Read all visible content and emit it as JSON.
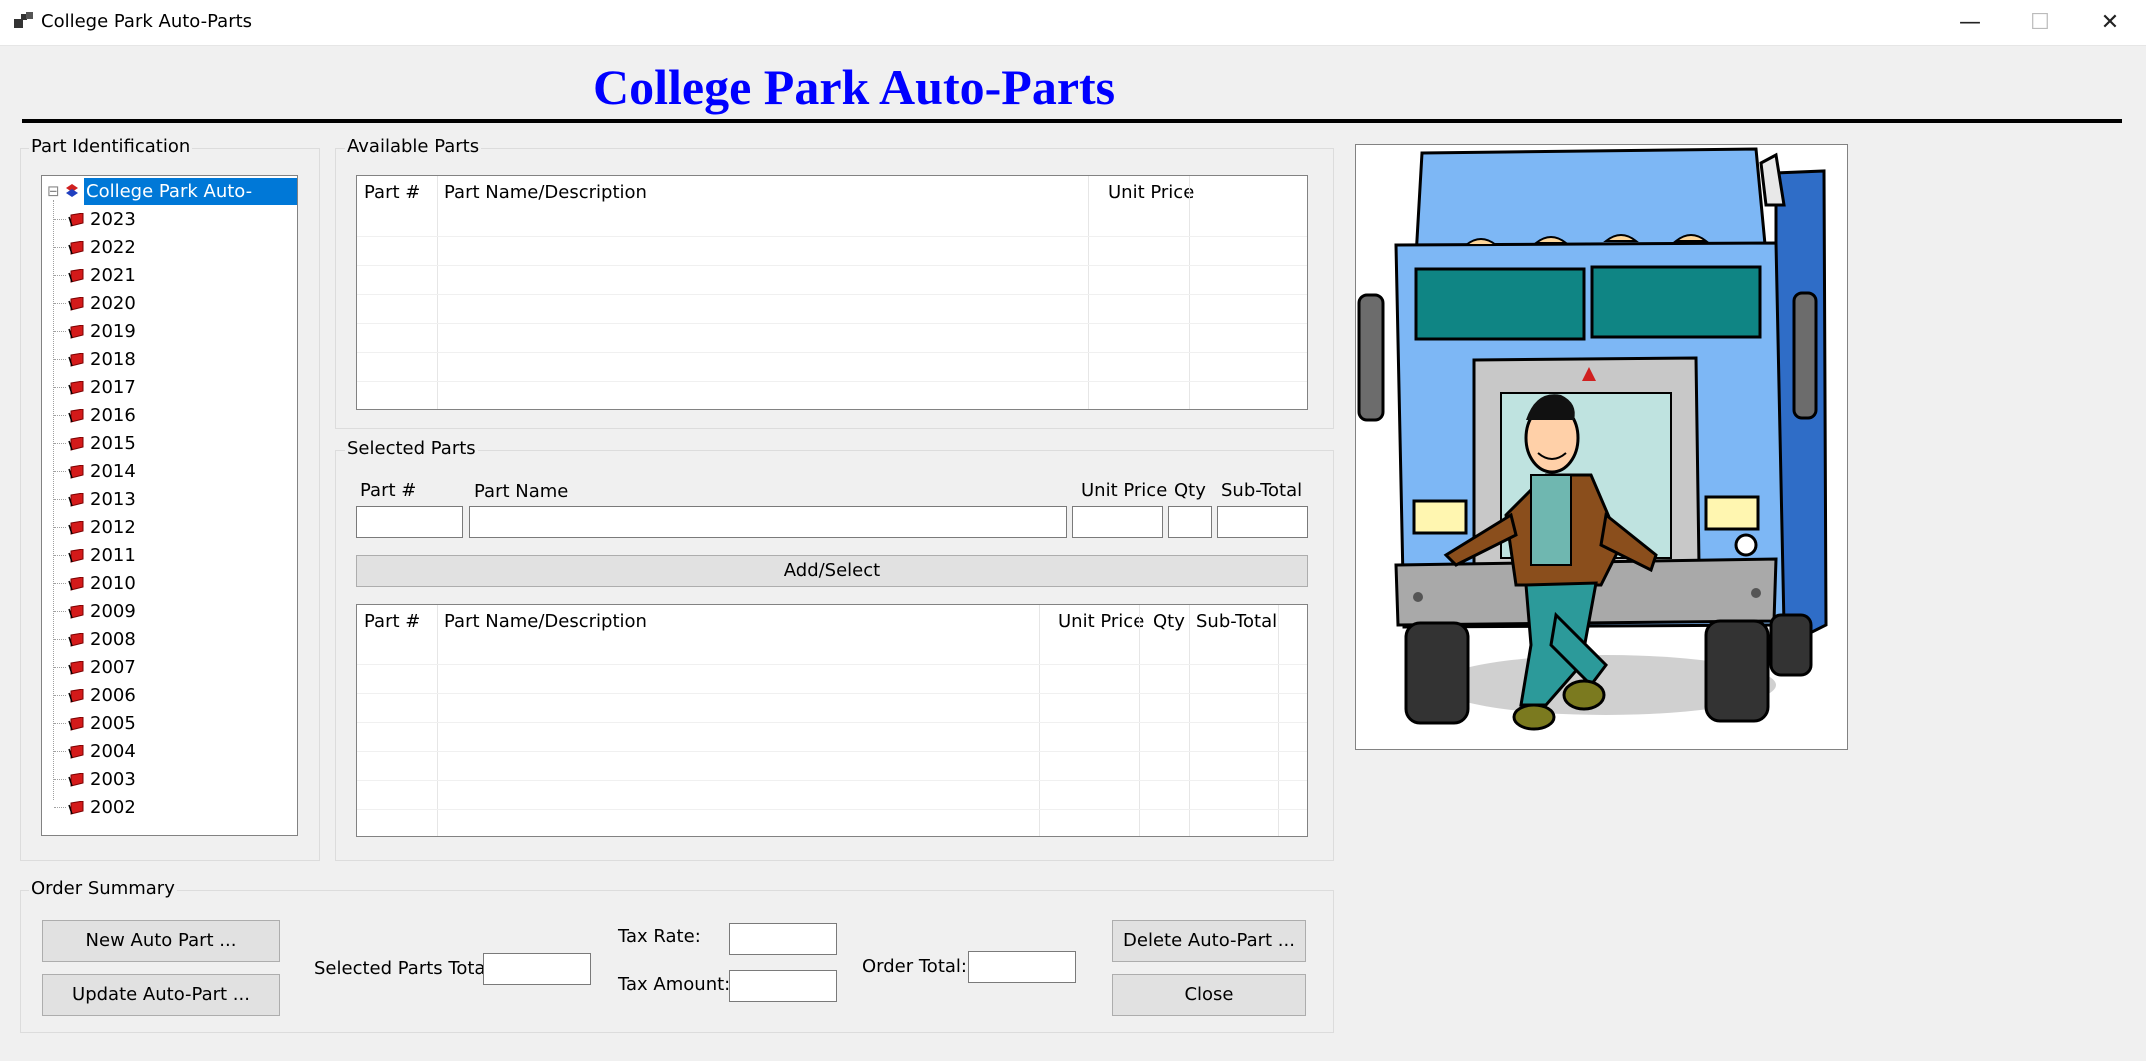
{
  "window": {
    "title": "College Park Auto-Parts",
    "minimize": "—",
    "maximize": "☐",
    "close": "✕"
  },
  "header": {
    "title": "College Park Auto-Parts"
  },
  "part_identification": {
    "label": "Part Identification",
    "root": "College Park Auto-Parts",
    "collapse_glyph": "⊟",
    "years": [
      "2023",
      "2022",
      "2021",
      "2020",
      "2019",
      "2018",
      "2017",
      "2016",
      "2015",
      "2014",
      "2013",
      "2012",
      "2011",
      "2010",
      "2009",
      "2008",
      "2007",
      "2006",
      "2005",
      "2004",
      "2003",
      "2002"
    ]
  },
  "available_parts": {
    "label": "Available Parts",
    "columns": [
      "Part #",
      "Part Name/Description",
      "Unit Price"
    ]
  },
  "selected_parts": {
    "label": "Selected Parts",
    "field_labels": {
      "part_no": "Part #",
      "part_name": "Part Name",
      "unit_price": "Unit Price",
      "qty": "Qty",
      "subtotal": "Sub-Total"
    },
    "add_button": "Add/Select",
    "columns": [
      "Part #",
      "Part Name/Description",
      "Unit Price",
      "Qty",
      "Sub-Total"
    ]
  },
  "order_summary": {
    "label": "Order Summary",
    "new_button": "New Auto Part ...",
    "update_button": "Update Auto-Part ...",
    "selected_total_label": "Selected Parts Total:",
    "tax_rate_label": "Tax Rate:",
    "tax_amount_label": "Tax Amount:",
    "order_total_label": "Order Total:",
    "delete_button": "Delete Auto-Part ...",
    "close_button": "Close"
  }
}
